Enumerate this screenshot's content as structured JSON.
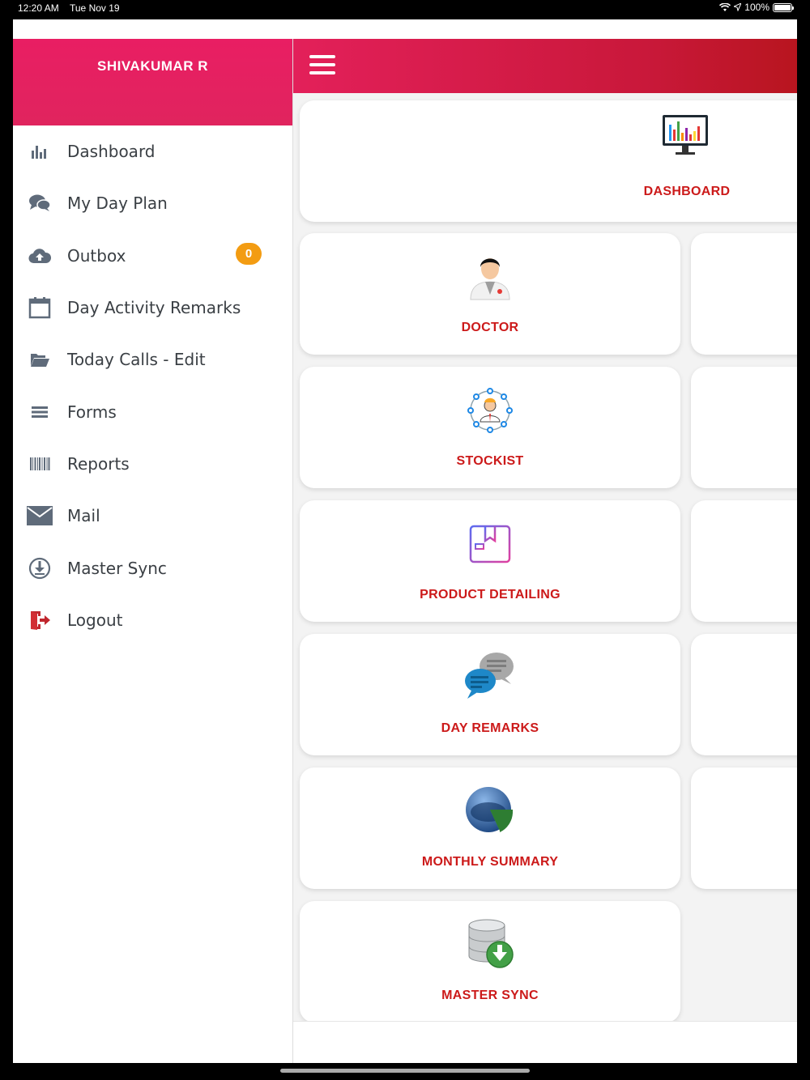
{
  "status": {
    "time": "12:20 AM",
    "date": "Tue Nov 19",
    "battery": "100%"
  },
  "drawer": {
    "username": "SHIVAKUMAR R",
    "items": [
      {
        "label": "Dashboard",
        "icon": "bar-chart-icon"
      },
      {
        "label": "My Day Plan",
        "icon": "chat-bubbles-icon"
      },
      {
        "label": "Outbox",
        "icon": "cloud-upload-icon",
        "badge": "0"
      },
      {
        "label": "Day Activity Remarks",
        "icon": "calendar-icon"
      },
      {
        "label": "Today Calls - Edit",
        "icon": "folder-open-icon"
      },
      {
        "label": "Forms",
        "icon": "list-icon"
      },
      {
        "label": "Reports",
        "icon": "barcode-icon"
      },
      {
        "label": "Mail",
        "icon": "envelope-icon"
      },
      {
        "label": "Master Sync",
        "icon": "download-circle-icon"
      },
      {
        "label": "Logout",
        "icon": "logout-icon"
      }
    ]
  },
  "tiles": {
    "dashboard": "DASHBOARD",
    "doctor": "DOCTOR",
    "stockist": "STOCKIST",
    "product_detailing": "PRODUCT DETAILING",
    "day_remarks": "DAY REMARKS",
    "monthly_summary": "MONTHLY SUMMARY",
    "master_sync": "MASTER SYNC"
  },
  "colors": {
    "accent": "#e91e63",
    "appbar_end": "#b8151f",
    "tile_label": "#cc1a1a",
    "badge": "#f39c12",
    "icon_grey": "#5f6b7a"
  }
}
